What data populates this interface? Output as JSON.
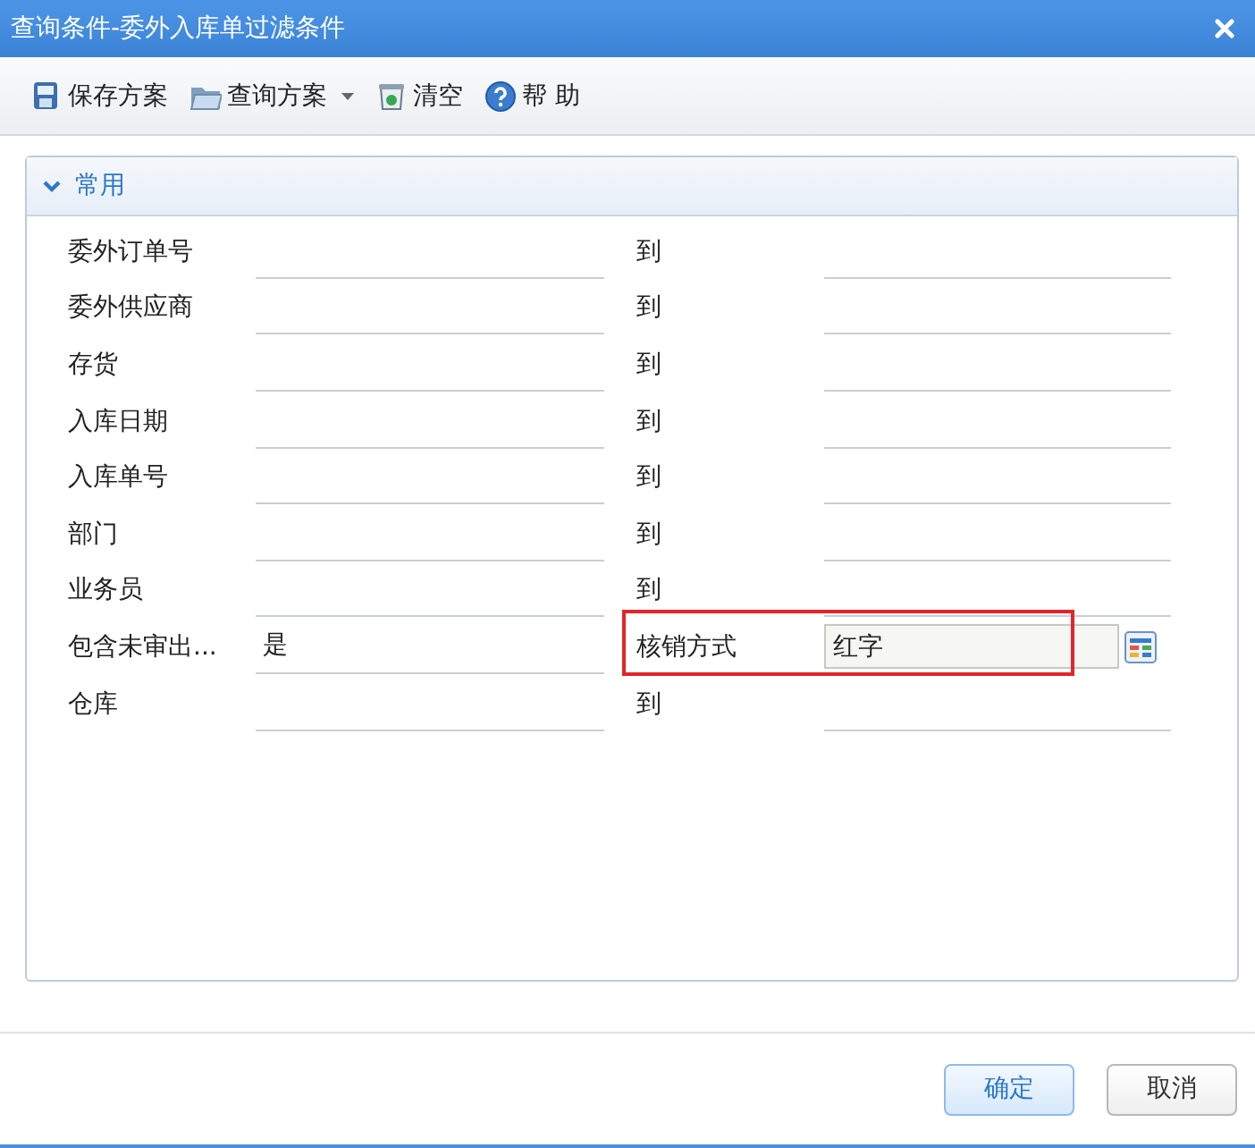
{
  "window": {
    "title": "查询条件-委外入库单过滤条件"
  },
  "toolbar": [
    {
      "label": "保存方案",
      "kind": "save",
      "dropdown": false
    },
    {
      "label": "查询方案",
      "kind": "folder",
      "dropdown": true
    },
    {
      "label": "清空",
      "kind": "bin",
      "dropdown": false
    },
    {
      "label": "帮 助",
      "kind": "help",
      "dropdown": false
    }
  ],
  "section": {
    "title": "常用",
    "expanded": true,
    "rows": [
      {
        "kind": "range",
        "label": "委外订单号",
        "to": "到"
      },
      {
        "kind": "range",
        "label": "委外供应商",
        "to": "到"
      },
      {
        "kind": "range",
        "label": "存货",
        "to": "到"
      },
      {
        "kind": "range",
        "label": "入库日期",
        "to": "到"
      },
      {
        "kind": "range",
        "label": "入库单号",
        "to": "到"
      },
      {
        "kind": "range",
        "label": "部门",
        "to": "到"
      },
      {
        "kind": "range",
        "label": "业务员",
        "to": "到"
      },
      {
        "kind": "pair",
        "label": "包含未审出...",
        "value": "是",
        "label2": "核销方式",
        "value2": "红字",
        "highlighted": true
      },
      {
        "kind": "range",
        "label": "仓库",
        "to": "到"
      }
    ]
  },
  "buttons": [
    {
      "label": "确定",
      "default": true
    },
    {
      "label": "取消",
      "default": false
    }
  ]
}
